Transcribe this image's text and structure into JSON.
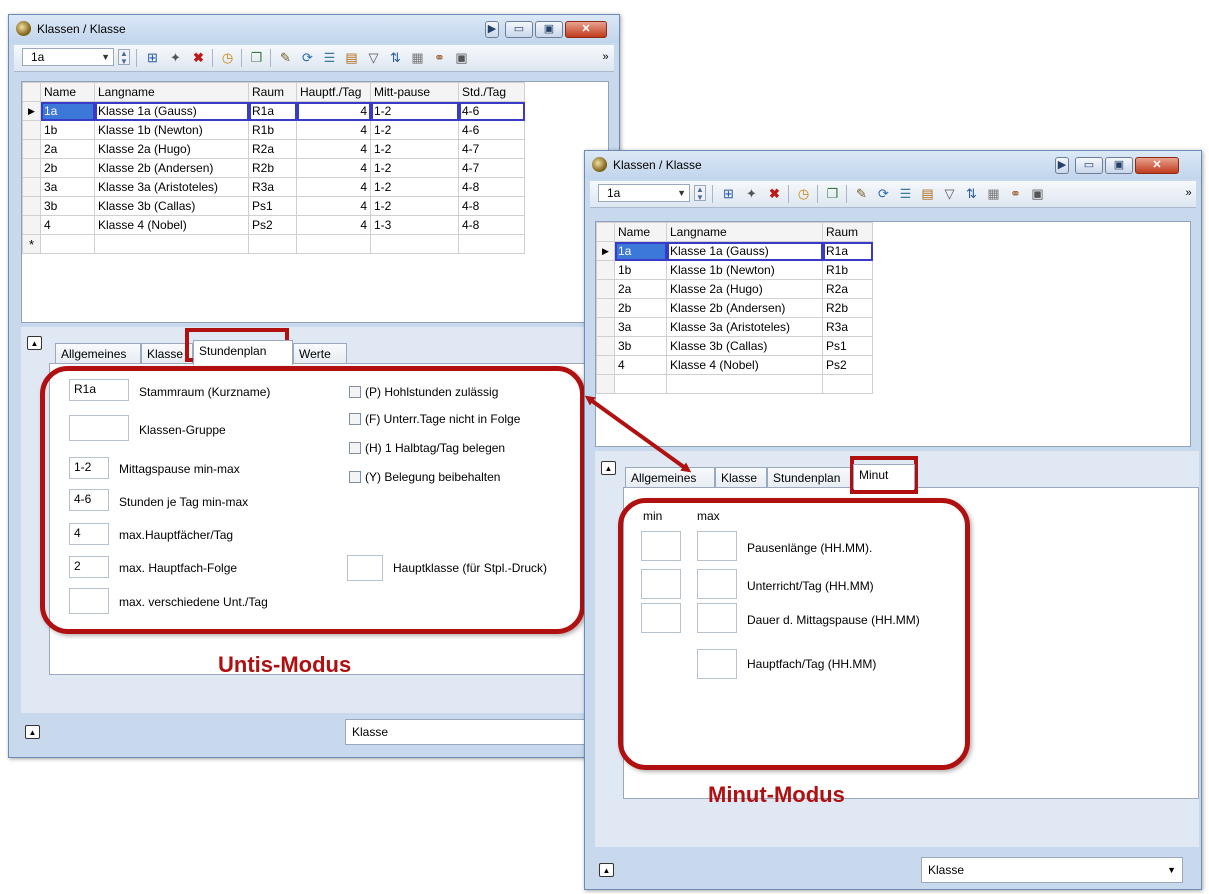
{
  "left": {
    "title": "Klassen / Klasse",
    "combo_value": "1a",
    "columns": [
      "Name",
      "Langname",
      "Raum",
      "Hauptf./Tag",
      "Mitt-pause",
      "Std./Tag"
    ],
    "rows": [
      {
        "name": "1a",
        "lang": "Klasse 1a (Gauss)",
        "raum": "R1a",
        "hpt": "4",
        "mitt": "1-2",
        "std": "4-6"
      },
      {
        "name": "1b",
        "lang": "Klasse 1b (Newton)",
        "raum": "R1b",
        "hpt": "4",
        "mitt": "1-2",
        "std": "4-6"
      },
      {
        "name": "2a",
        "lang": "Klasse 2a (Hugo)",
        "raum": "R2a",
        "hpt": "4",
        "mitt": "1-2",
        "std": "4-7"
      },
      {
        "name": "2b",
        "lang": "Klasse 2b (Andersen)",
        "raum": "R2b",
        "hpt": "4",
        "mitt": "1-2",
        "std": "4-7"
      },
      {
        "name": "3a",
        "lang": "Klasse 3a (Aristoteles)",
        "raum": "R3a",
        "hpt": "4",
        "mitt": "1-2",
        "std": "4-8"
      },
      {
        "name": "3b",
        "lang": "Klasse 3b (Callas)",
        "raum": "Ps1",
        "hpt": "4",
        "mitt": "1-2",
        "std": "4-8"
      },
      {
        "name": "4",
        "lang": "Klasse 4 (Nobel)",
        "raum": "Ps2",
        "hpt": "4",
        "mitt": "1-3",
        "std": "4-8"
      }
    ],
    "new_row_marker": "*",
    "tabs": [
      "Allgemeines",
      "Klasse",
      "Stundenplan",
      "Werte"
    ],
    "fields": {
      "stammraum_val": "R1a",
      "stammraum_lbl": "Stammraum (Kurzname)",
      "gruppe_lbl": "Klassen-Gruppe",
      "mittag_val": "1-2",
      "mittag_lbl": "Mittagspause min-max",
      "stunden_val": "4-6",
      "stunden_lbl": "Stunden je Tag min-max",
      "hauptf_val": "4",
      "hauptf_lbl": "max.Hauptfächer/Tag",
      "folge_val": "2",
      "folge_lbl": "max. Hauptfach-Folge",
      "versch_lbl": "max. verschiedene Unt./Tag",
      "hauptklasse_lbl": "Hauptklasse (für Stpl.-Druck)"
    },
    "checks": [
      "(P) Hohlstunden zulässig",
      "(F) Unterr.Tage nicht in Folge",
      "(H) 1 Halbtag/Tag belegen",
      "(Y) Belegung beibehalten"
    ],
    "mode_label": "Untis-Modus",
    "status_value": "Klasse"
  },
  "right": {
    "title": "Klassen / Klasse",
    "combo_value": "1a",
    "columns": [
      "Name",
      "Langname",
      "Raum"
    ],
    "rows": [
      {
        "name": "1a",
        "lang": "Klasse 1a (Gauss)",
        "raum": "R1a"
      },
      {
        "name": "1b",
        "lang": "Klasse 1b (Newton)",
        "raum": "R1b"
      },
      {
        "name": "2a",
        "lang": "Klasse 2a (Hugo)",
        "raum": "R2a"
      },
      {
        "name": "2b",
        "lang": "Klasse 2b (Andersen)",
        "raum": "R2b"
      },
      {
        "name": "3a",
        "lang": "Klasse 3a (Aristoteles)",
        "raum": "R3a"
      },
      {
        "name": "3b",
        "lang": "Klasse 3b (Callas)",
        "raum": "Ps1"
      },
      {
        "name": "4",
        "lang": "Klasse 4 (Nobel)",
        "raum": "Ps2"
      }
    ],
    "tabs": [
      "Allgemeines",
      "Klasse",
      "Stundenplan",
      "Minut"
    ],
    "min_lbl": "min",
    "max_lbl": "max",
    "minut_fields": [
      "Pausenlänge (HH.MM).",
      "Unterricht/Tag (HH.MM)",
      "Dauer d. Mittagspause (HH.MM)",
      "Hauptfach/Tag (HH.MM)"
    ],
    "mode_label": "Minut-Modus",
    "status_value": "Klasse"
  },
  "icons": [
    "window-clock-icon",
    "add-icon",
    "new-icon",
    "delete-icon",
    "clock-icon",
    "copy-icon",
    "edit-icon",
    "refresh-icon",
    "list-icon",
    "report-icon",
    "filter-icon",
    "sort-icon",
    "grid-icon",
    "link-icon",
    "settings-icon",
    "more-icon"
  ],
  "colors": {
    "accent": "#b01010",
    "selection": "#3b78d8"
  }
}
